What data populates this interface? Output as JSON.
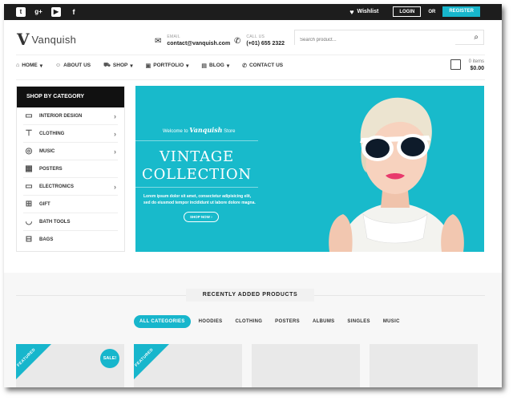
{
  "topbar": {
    "social": [
      "twitter",
      "google-plus",
      "youtube",
      "facebook"
    ],
    "wishlist": "Wishlist",
    "login": "LOGIN",
    "or": "OR",
    "register": "REGISTER"
  },
  "header": {
    "logo": "Vanquish",
    "email_label": "EMAIL",
    "email": "contact@vanquish.com",
    "call_label": "CALL US",
    "phone": "(+01) 655 2322",
    "search_placeholder": "Search product..."
  },
  "nav": {
    "items": [
      "HOME",
      "ABOUT US",
      "SHOP",
      "PORTFOLIO",
      "BLOG",
      "CONTACT US"
    ],
    "cart_items": "0 items",
    "cart_total": "$0.00"
  },
  "categories": {
    "title": "SHOP BY CATEGORY",
    "items": [
      {
        "label": "INTERIOR DESIGN",
        "icon": "sofa-icon"
      },
      {
        "label": "CLOTHING",
        "icon": "shirt-icon"
      },
      {
        "label": "MUSIC",
        "icon": "disc-icon"
      },
      {
        "label": "POSTERS",
        "icon": "poster-icon"
      },
      {
        "label": "ELECTRONICS",
        "icon": "monitor-icon"
      },
      {
        "label": "GIFT",
        "icon": "gift-icon"
      },
      {
        "label": "BATH TOOLS",
        "icon": "bathtub-icon"
      },
      {
        "label": "BAGS",
        "icon": "bag-icon"
      }
    ]
  },
  "hero": {
    "welcome_pre": "Welcome to",
    "welcome_brand": "Vanquish",
    "welcome_post": "Store",
    "title_line1": "VINTAGE",
    "title_line2": "COLLECTION",
    "subtitle": "Lorem ipsum dolor sit amet, consectetur adipisicing elit, sed do eiusmod tempor incididunt ut labore dolore magna.",
    "button": "SHOP NOW"
  },
  "recent": {
    "title": "RECENTLY ADDED PRODUCTS",
    "filters": [
      "ALL CATEGORIES",
      "HOODIES",
      "CLOTHING",
      "POSTERS",
      "ALBUMS",
      "SINGLES",
      "MUSIC"
    ],
    "badge_featured": "FEATURED",
    "badge_sale": "SALE!"
  },
  "colors": {
    "accent": "#17b6cc",
    "dark": "#1d1d1d"
  }
}
